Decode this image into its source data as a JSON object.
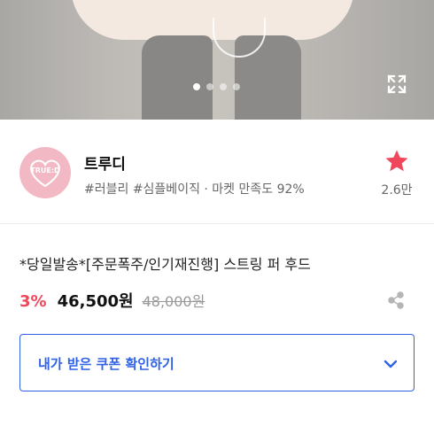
{
  "hero": {
    "slide_count": 4,
    "active_slide": 1,
    "expand_icon": "expand-icon"
  },
  "store": {
    "logo_text": "TRUE:D",
    "name": "트루디",
    "tags": "#러블리 #심플베이직 · 마켓 만족도 92%",
    "favorite_icon": "star-icon",
    "favorite_count": "2.6만",
    "accent_color": "#f0475c"
  },
  "product": {
    "title": "*당일발송*[주문폭주/인기재진행] 스트링 퍼 후드",
    "discount": "3%",
    "price": "46,500원",
    "original_price": "48,000원",
    "share_icon": "share-icon"
  },
  "coupon": {
    "label": "내가 받은 쿠폰 확인하기",
    "icon": "chevron-down-icon",
    "color": "#2f62e6"
  }
}
